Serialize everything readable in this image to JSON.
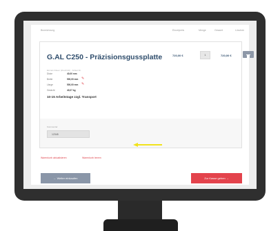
{
  "table_headers": [
    "Bezeichnung",
    "Einzelpreis",
    "Menge",
    "Gesamt",
    "Löschen"
  ],
  "item": {
    "title": "G.AL C250 - Präzisionsgussplatte",
    "subtitle": "Einzeln fräsen (Zuschnitt) · Artikel-Nr.",
    "specs": [
      {
        "label": "Dicke",
        "value": "40,00 mm",
        "editable": false
      },
      {
        "label": "Breite",
        "value": "500,00 mm",
        "editable": true
      },
      {
        "label": "Länge",
        "value": "500,00 mm",
        "editable": true
      },
      {
        "label": "Gewicht",
        "value": "40,07 kg",
        "editable": false
      }
    ],
    "delivery": "10-15 Arbeitstage zzgl. Transport",
    "unit_price": "720,00 €",
    "quantity": "1",
    "total": "720,00 €"
  },
  "comment": {
    "label": "Kommentar",
    "value": "12345"
  },
  "links": {
    "edit": "Warenkorb aktualisieren",
    "clear": "Warenkorb leeren"
  },
  "buttons": {
    "back": "← Weiter einkaufen",
    "checkout": "Zur Kasse gehen →"
  },
  "colors": {
    "accent_red": "#e3434c",
    "title_blue": "#2f4d6c",
    "highlight_arrow": "#f1e21b",
    "frame": "#2f2f2f"
  }
}
